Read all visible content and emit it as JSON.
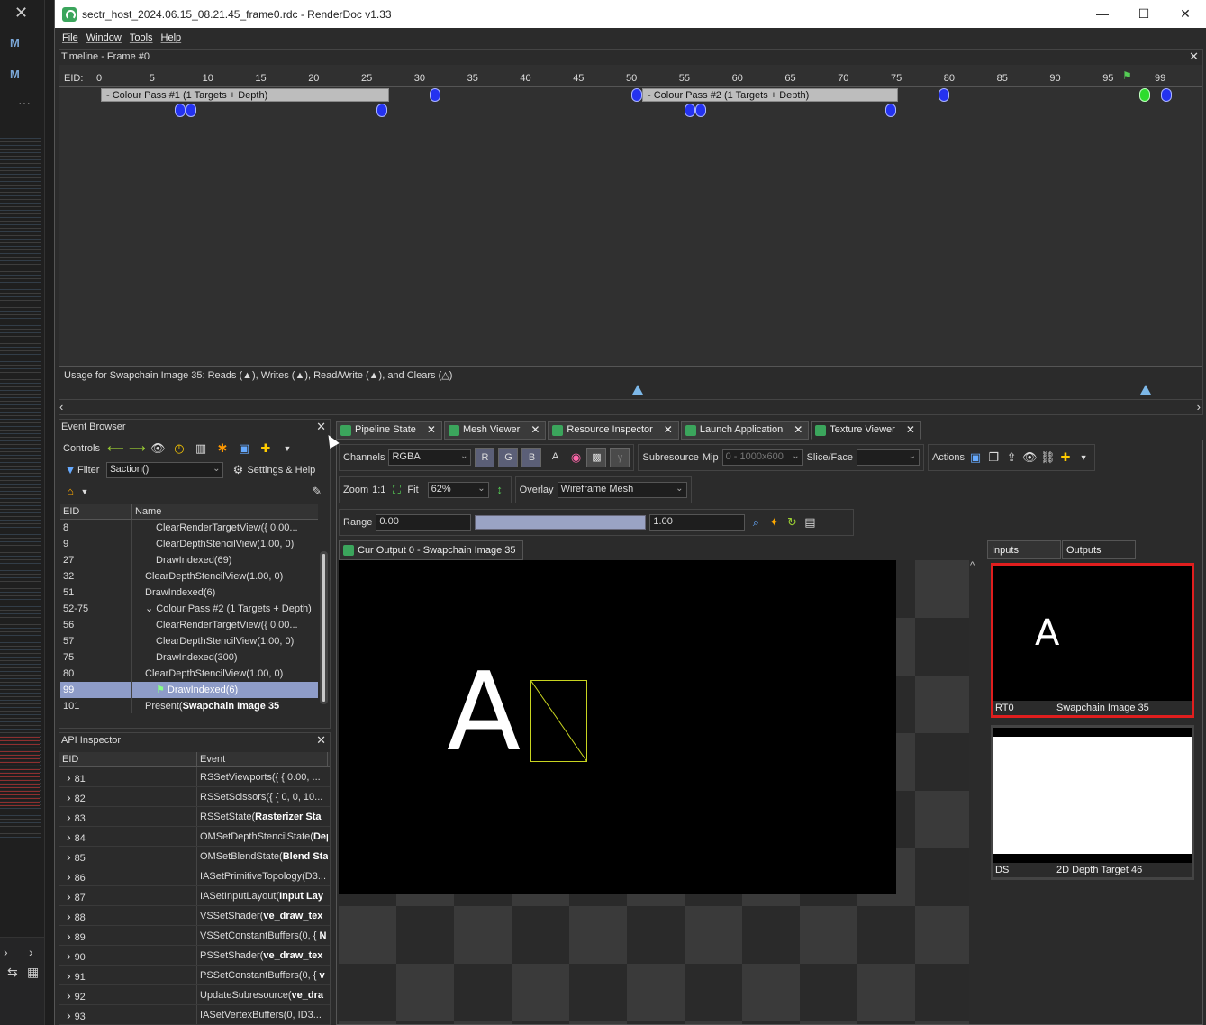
{
  "window": {
    "title": "sectr_host_2024.06.15_08.21.45_frame0.rdc - RenderDoc v1.33",
    "minimize": "—",
    "maximize": "☐",
    "close": "✕"
  },
  "left_strip": {
    "m1": "M",
    "m2": "M",
    "dots": "···"
  },
  "menu": {
    "file": "File",
    "window": "Window",
    "tools": "Tools",
    "help": "Help"
  },
  "timeline": {
    "header": "Timeline - Frame #0",
    "eid_label": "EID:",
    "ticks": [
      "0",
      "5",
      "10",
      "15",
      "20",
      "25",
      "30",
      "35",
      "40",
      "45",
      "50",
      "55",
      "60",
      "65",
      "70",
      "75",
      "80",
      "85",
      "90",
      "95",
      "99"
    ],
    "pass1": "-  Colour Pass #1 (1 Targets + Depth)",
    "pass2": "-  Colour Pass #2 (1 Targets + Depth)",
    "usage": "Usage for Swapchain Image 35: Reads (▲), Writes (▲), Read/Write (▲), and Clears (△)"
  },
  "event_browser": {
    "header": "Event Browser",
    "controls_label": "Controls",
    "filter_label": "Filter",
    "filter_value": "$action()",
    "settings_label": "Settings & Help",
    "col_eid": "EID",
    "col_name": "Name",
    "rows": [
      {
        "eid": "8",
        "name": "ClearRenderTargetView({ 0.00..."
      },
      {
        "eid": "9",
        "name": "ClearDepthStencilView(1.00, 0)"
      },
      {
        "eid": "27",
        "name": "DrawIndexed(69)"
      },
      {
        "eid": "32",
        "name": "ClearDepthStencilView(1.00, 0)"
      },
      {
        "eid": "51",
        "name": "DrawIndexed(6)"
      },
      {
        "eid": "52-75",
        "name": "Colour Pass #2 (1 Targets + Depth)"
      },
      {
        "eid": "56",
        "name": "ClearRenderTargetView({ 0.00..."
      },
      {
        "eid": "57",
        "name": "ClearDepthStencilView(1.00, 0)"
      },
      {
        "eid": "75",
        "name": "DrawIndexed(300)"
      },
      {
        "eid": "80",
        "name": "ClearDepthStencilView(1.00, 0)"
      },
      {
        "eid": "99",
        "name": "DrawIndexed(6)"
      },
      {
        "eid": "101",
        "name": "Present(Swapchain Image 35"
      }
    ]
  },
  "api_inspector": {
    "header": "API Inspector",
    "col_eid": "EID",
    "col_event": "Event",
    "rows": [
      {
        "eid": "81",
        "pre": "RSSetViewports({ { 0.00, ...",
        "bold": ""
      },
      {
        "eid": "82",
        "pre": "RSSetScissors({ { 0, 0, 10...",
        "bold": ""
      },
      {
        "eid": "83",
        "pre": "RSSetState(",
        "bold": "Rasterizer Sta"
      },
      {
        "eid": "84",
        "pre": "OMSetDepthStencilState(",
        "bold": "Dep"
      },
      {
        "eid": "85",
        "pre": "OMSetBlendState(",
        "bold": "Blend Sta"
      },
      {
        "eid": "86",
        "pre": "IASetPrimitiveTopology(D3...",
        "bold": ""
      },
      {
        "eid": "87",
        "pre": "IASetInputLayout(",
        "bold": "Input Lay"
      },
      {
        "eid": "88",
        "pre": "VSSetShader(",
        "bold": "ve_draw_tex"
      },
      {
        "eid": "89",
        "pre": "VSSetConstantBuffers(0, { ",
        "bold": "N"
      },
      {
        "eid": "90",
        "pre": "PSSetShader(",
        "bold": "ve_draw_tex"
      },
      {
        "eid": "91",
        "pre": "PSSetConstantBuffers(0, { ",
        "bold": "v"
      },
      {
        "eid": "92",
        "pre": "UpdateSubresource(",
        "bold": "ve_dra"
      },
      {
        "eid": "93",
        "pre": "IASetVertexBuffers(0, ID3...",
        "bold": ""
      }
    ]
  },
  "tabs": [
    {
      "label": "Pipeline State"
    },
    {
      "label": "Mesh Viewer"
    },
    {
      "label": "Resource Inspector"
    },
    {
      "label": "Launch Application"
    },
    {
      "label": "Texture Viewer"
    }
  ],
  "texture_viewer": {
    "channels_label": "Channels",
    "channels_value": "RGBA",
    "r": "R",
    "g": "G",
    "b": "B",
    "a": "A",
    "gamma": "γ",
    "subresource_label": "Subresource",
    "mip_label": "Mip",
    "mip_value": "0 - 1000x600",
    "slice_label": "Slice/Face",
    "actions_label": "Actions",
    "zoom_label": "Zoom",
    "zoom_11": "1:1",
    "fit_label": "Fit",
    "zoom_value": "62%",
    "overlay_label": "Overlay",
    "overlay_value": "Wireframe Mesh",
    "range_label": "Range",
    "range_min": "0.00",
    "range_max": "1.00",
    "output_tab": "Cur Output 0 - Swapchain Image 35",
    "render_text": "A",
    "inputs_tab": "Inputs",
    "outputs_tab": "Outputs",
    "thumb1_slot": "RT0",
    "thumb1_name": "Swapchain Image 35",
    "thumb1_text": "A",
    "thumb2_slot": "DS",
    "thumb2_name": "2D Depth Target 46"
  }
}
